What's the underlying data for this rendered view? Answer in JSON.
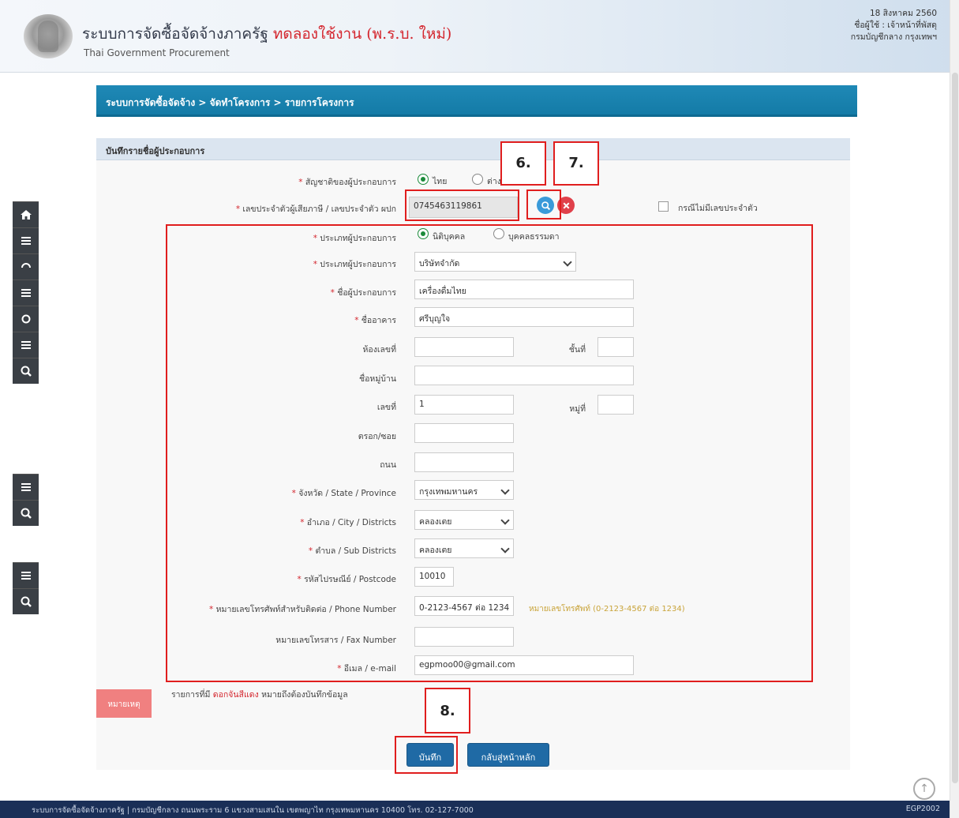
{
  "header": {
    "title_main": "ระบบการจัดซื้อจัดจ้างภาครัฐ",
    "title_suffix": "ทดลองใช้งาน (พ.ร.บ. ใหม่)",
    "title_en": "Thai Government Procurement",
    "date": "18 สิงหาคม 2560",
    "user": "ชื่อผู้ใช้ : เจ้าหน้าที่พัสดุ",
    "org": "กรมบัญชีกลาง กรุงเทพฯ"
  },
  "breadcrumb": "ระบบการจัดซื้อจัดจ้าง > จัดทำโครงการ > รายการโครงการ",
  "panel_title": "บันทึกรายชื่อผู้ประกอบการ",
  "form": {
    "nationality_label": "สัญชาติของผู้ประกอบการ",
    "nationality_thai": "ไทย",
    "nationality_foreign": "ต่างชาติ",
    "taxid_label": "เลขประจำตัวผู้เสียภาษี / เลขประจำตัว ผปก",
    "taxid_value": "0745463119861",
    "no_taxid_label": "กรณีไม่มีเลขประจำตัว",
    "type_label": "ประเภทผู้ประกอบการ",
    "type_juristic": "นิติบุคคล",
    "type_person": "บุคคลธรรมดา",
    "category_label": "ประเภทผู้ประกอบการ",
    "category_value": "บริษัทจำกัด",
    "name_label": "ชื่อผู้ประกอบการ",
    "name_value": "เครื่องดื่มไทย",
    "building_label": "ชื่ออาคาร",
    "building_value": "ศรีบุญใจ",
    "room_label": "ห้องเลขที่",
    "room_value": "",
    "floor_label": "ชั้นที่",
    "floor_value": "",
    "village_label": "ชื่อหมู่บ้าน",
    "village_value": "",
    "addrno_label": "เลขที่",
    "addrno_value": "1",
    "moo_label": "หมู่ที่",
    "moo_value": "",
    "soi_label": "ตรอก/ซอย",
    "soi_value": "",
    "road_label": "ถนน",
    "road_value": "",
    "province_label": "จังหวัด / State / Province",
    "province_value": "กรุงเทพมหานคร",
    "district_label": "อำเภอ / City / Districts",
    "district_value": "คลองเตย",
    "subdistrict_label": "ตำบล / Sub Districts",
    "subdistrict_value": "คลองเตย",
    "postcode_label": "รหัสไปรษณีย์ / Postcode",
    "postcode_value": "10010",
    "phone_label": "หมายเลขโทรศัพท์สำหรับติดต่อ / Phone Number",
    "phone_value": "0-2123-4567 ต่อ 1234",
    "phone_hint": "หมายเลขโทรศัพท์ (0-2123-4567 ต่อ 1234)",
    "fax_label": "หมายเลขโทรสาร / Fax Number",
    "fax_value": "",
    "email_label": "อีเมล / e-mail",
    "email_value": "egpmoo00@gmail.com"
  },
  "note": {
    "tag": "หมายเหตุ",
    "prefix": "รายการที่มี",
    "red": "ดอกจันสีแดง",
    "suffix": "หมายถึงต้องบันทึกข้อมูล"
  },
  "buttons": {
    "save": "บันทึก",
    "back": "กลับสู่หน้าหลัก"
  },
  "callouts": {
    "c6": "6.",
    "c7": "7.",
    "c8": "8."
  },
  "footer": {
    "text": "ระบบการจัดซื้อจัดจ้างภาครัฐ | กรมบัญชีกลาง ถนนพระราม 6 แขวงสามเสนใน เขตพญาไท กรุงเทพมหานคร 10400 โทร. 02-127-7000",
    "version": "EGP2002"
  },
  "colors": {
    "accent": "#1f89b6",
    "annotation": "#e01e1e",
    "required": "#d4262e"
  }
}
